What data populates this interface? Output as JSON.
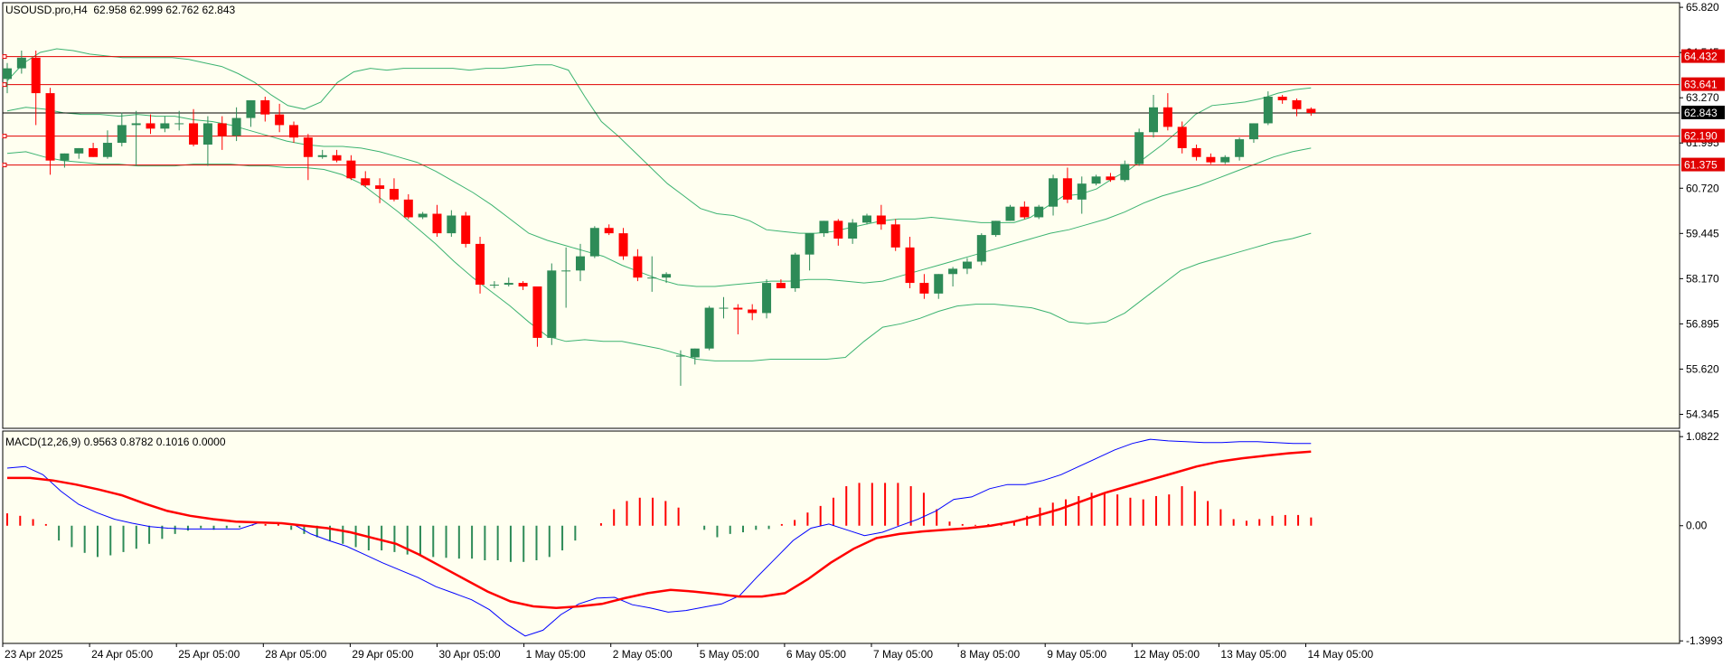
{
  "header": {
    "symbol_line": "USOUSD.pro,H4  62.958 62.999 62.762 62.843",
    "macd_line": "MACD(12,26,9) 0.9563 0.8782 0.1016 0.0000"
  },
  "colors": {
    "background": "#fffff0",
    "frame": "#000000",
    "bull": "#2e8b57",
    "bear": "#ff0000",
    "band": "#3cb371",
    "hline": "#e00000",
    "price_line": "#000000",
    "macd_main": "#0000ff",
    "macd_signal": "#ff0000"
  },
  "chart_data": [
    {
      "type": "candlestick",
      "title": "USOUSD.pro,H4",
      "ohlc_header": "62.958 62.999 62.762 62.843",
      "y_ticks": [
        "65.820",
        "64.545",
        "63.270",
        "61.995",
        "60.720",
        "59.445",
        "58.170",
        "56.895",
        "55.620",
        "54.345"
      ],
      "ylim": [
        53.95,
        65.95
      ],
      "x_labels": [
        "23 Apr 2025",
        "24 Apr 05:00",
        "25 Apr 05:00",
        "28 Apr 05:00",
        "29 Apr 05:00",
        "30 Apr 05:00",
        "1 May 05:00",
        "2 May 05:00",
        "5 May 05:00",
        "6 May 05:00",
        "7 May 05:00",
        "8 May 05:00",
        "9 May 05:00",
        "12 May 05:00",
        "13 May 05:00",
        "14 May 05:00"
      ],
      "horizontal_levels": [
        "64.432",
        "63.641",
        "62.190",
        "61.375"
      ],
      "current_price": "62.843",
      "candles": [
        [
          63.8,
          64.25,
          63.4,
          64.1
        ],
        [
          64.1,
          64.6,
          63.95,
          64.4
        ],
        [
          64.4,
          64.6,
          62.5,
          63.4
        ],
        [
          63.4,
          63.55,
          61.1,
          61.5
        ],
        [
          61.5,
          61.7,
          61.3,
          61.7
        ],
        [
          61.7,
          61.85,
          61.55,
          61.85
        ],
        [
          61.85,
          62.0,
          61.6,
          61.6
        ],
        [
          61.6,
          62.35,
          61.55,
          62.0
        ],
        [
          62.0,
          62.85,
          61.9,
          62.5
        ],
        [
          62.5,
          62.9,
          61.35,
          62.55
        ],
        [
          62.55,
          62.8,
          62.25,
          62.4
        ],
        [
          62.4,
          62.75,
          62.3,
          62.55
        ],
        [
          62.55,
          62.9,
          62.35,
          62.55
        ],
        [
          62.55,
          62.95,
          61.9,
          61.95
        ],
        [
          61.95,
          62.75,
          61.35,
          62.55
        ],
        [
          62.55,
          62.75,
          61.8,
          62.2
        ],
        [
          62.2,
          63.0,
          62.05,
          62.7
        ],
        [
          62.7,
          63.2,
          62.45,
          63.2
        ],
        [
          63.2,
          63.3,
          62.6,
          62.8
        ],
        [
          62.8,
          63.1,
          62.3,
          62.5
        ],
        [
          62.5,
          62.6,
          62.0,
          62.15
        ],
        [
          62.15,
          62.25,
          60.95,
          61.6
        ],
        [
          61.6,
          61.8,
          61.55,
          61.65
        ],
        [
          61.65,
          61.8,
          61.45,
          61.5
        ],
        [
          61.5,
          61.65,
          60.95,
          61.0
        ],
        [
          61.0,
          61.2,
          60.75,
          60.8
        ],
        [
          60.8,
          61.0,
          60.3,
          60.7
        ],
        [
          60.7,
          61.0,
          60.35,
          60.4
        ],
        [
          60.4,
          60.55,
          59.85,
          59.9
        ],
        [
          59.9,
          60.05,
          59.85,
          60.0
        ],
        [
          60.0,
          60.25,
          59.35,
          59.45
        ],
        [
          59.45,
          60.1,
          59.35,
          59.95
        ],
        [
          59.95,
          60.05,
          59.05,
          59.15
        ],
        [
          59.15,
          59.35,
          57.75,
          58.0
        ],
        [
          58.0,
          58.1,
          57.9,
          58.0
        ],
        [
          58.0,
          58.2,
          57.95,
          58.05
        ],
        [
          58.05,
          58.1,
          57.85,
          57.95
        ],
        [
          57.95,
          57.95,
          56.25,
          56.5
        ],
        [
          56.5,
          58.6,
          56.3,
          58.4
        ],
        [
          58.4,
          59.05,
          57.35,
          58.4
        ],
        [
          58.4,
          59.15,
          58.1,
          58.8
        ],
        [
          58.8,
          59.65,
          58.75,
          59.6
        ],
        [
          59.6,
          59.7,
          59.4,
          59.45
        ],
        [
          59.45,
          59.6,
          58.7,
          58.8
        ],
        [
          58.8,
          59.0,
          58.1,
          58.2
        ],
        [
          58.2,
          58.8,
          57.8,
          58.2
        ],
        [
          58.2,
          58.35,
          58.05,
          58.3
        ],
        [
          56.0,
          56.15,
          55.15,
          56.0
        ],
        [
          55.95,
          56.2,
          55.75,
          56.2
        ],
        [
          56.2,
          57.4,
          56.15,
          57.35
        ],
        [
          57.35,
          57.65,
          57.05,
          57.35
        ],
        [
          57.35,
          57.45,
          56.6,
          57.3
        ],
        [
          57.3,
          57.45,
          57.0,
          57.2
        ],
        [
          57.2,
          58.15,
          57.05,
          58.05
        ],
        [
          58.05,
          58.15,
          57.9,
          57.9
        ],
        [
          57.9,
          58.9,
          57.8,
          58.85
        ],
        [
          58.85,
          59.45,
          58.4,
          59.45
        ],
        [
          59.45,
          59.8,
          59.35,
          59.8
        ],
        [
          59.8,
          59.85,
          59.1,
          59.3
        ],
        [
          59.3,
          59.85,
          59.15,
          59.75
        ],
        [
          59.75,
          60.0,
          59.7,
          59.95
        ],
        [
          59.95,
          60.25,
          59.55,
          59.7
        ],
        [
          59.7,
          59.85,
          58.95,
          59.05
        ],
        [
          59.05,
          59.35,
          57.9,
          58.05
        ],
        [
          58.05,
          58.3,
          57.6,
          57.75
        ],
        [
          57.75,
          58.3,
          57.6,
          58.3
        ],
        [
          58.3,
          58.5,
          57.95,
          58.45
        ],
        [
          58.45,
          58.75,
          58.3,
          58.65
        ],
        [
          58.65,
          59.45,
          58.55,
          59.4
        ],
        [
          59.4,
          59.8,
          59.35,
          59.8
        ],
        [
          59.8,
          60.25,
          59.8,
          60.2
        ],
        [
          60.2,
          60.35,
          59.85,
          59.9
        ],
        [
          59.9,
          60.25,
          59.85,
          60.2
        ],
        [
          60.2,
          61.1,
          59.95,
          61.0
        ],
        [
          61.0,
          61.3,
          60.3,
          60.4
        ],
        [
          60.4,
          61.05,
          60.0,
          60.85
        ],
        [
          60.85,
          61.1,
          60.8,
          61.05
        ],
        [
          61.05,
          61.15,
          60.9,
          60.95
        ],
        [
          60.95,
          61.5,
          60.9,
          61.4
        ],
        [
          61.4,
          62.4,
          61.35,
          62.3
        ],
        [
          62.3,
          63.35,
          62.15,
          63.0
        ],
        [
          63.0,
          63.4,
          62.35,
          62.45
        ],
        [
          62.45,
          62.6,
          61.7,
          61.85
        ],
        [
          61.85,
          61.95,
          61.5,
          61.6
        ],
        [
          61.6,
          61.7,
          61.4,
          61.45
        ],
        [
          61.45,
          61.65,
          61.4,
          61.6
        ],
        [
          61.6,
          62.15,
          61.5,
          62.1
        ],
        [
          62.1,
          62.55,
          62.0,
          62.55
        ],
        [
          62.55,
          63.45,
          62.5,
          63.3
        ],
        [
          63.3,
          63.35,
          63.1,
          63.2
        ],
        [
          63.2,
          63.25,
          62.75,
          62.95
        ],
        [
          62.958,
          62.999,
          62.762,
          62.843
        ]
      ],
      "bollinger": {
        "upper": [
          63.75,
          64.25,
          64.55,
          64.65,
          64.6,
          64.5,
          64.45,
          64.4,
          64.4,
          64.4,
          64.4,
          64.35,
          64.25,
          64.15,
          63.95,
          63.7,
          63.35,
          63.05,
          62.95,
          63.15,
          63.7,
          64.0,
          64.1,
          64.05,
          64.1,
          64.1,
          64.1,
          64.1,
          64.05,
          64.1,
          64.1,
          64.15,
          64.2,
          64.2,
          64.05,
          63.3,
          62.6,
          62.2,
          61.75,
          61.3,
          60.85,
          60.5,
          60.15,
          60.0,
          59.95,
          59.8,
          59.55,
          59.5,
          59.45,
          59.45,
          59.5,
          59.6,
          59.7,
          59.8,
          59.85,
          59.85,
          59.9,
          59.85,
          59.8,
          59.75,
          59.75,
          59.75,
          59.9,
          60.2,
          60.5,
          60.55,
          60.7,
          61.0,
          61.25,
          61.6,
          61.95,
          62.35,
          62.8,
          63.05,
          63.1,
          63.15,
          63.25,
          63.4,
          63.5,
          63.55
        ],
        "middle": [
          62.9,
          63.0,
          62.95,
          62.85,
          62.8,
          62.8,
          62.75,
          62.8,
          62.75,
          62.75,
          62.65,
          62.6,
          62.5,
          62.35,
          62.2,
          62.05,
          61.95,
          61.9,
          61.9,
          61.85,
          61.75,
          61.6,
          61.45,
          61.2,
          60.9,
          60.6,
          60.25,
          59.85,
          59.45,
          59.25,
          59.1,
          58.95,
          58.8,
          58.55,
          58.35,
          58.15,
          58.0,
          57.95,
          57.95,
          58.0,
          58.05,
          58.1,
          58.1,
          58.15,
          58.15,
          58.1,
          58.05,
          58.1,
          58.25,
          58.4,
          58.55,
          58.7,
          58.85,
          59.0,
          59.15,
          59.3,
          59.45,
          59.55,
          59.7,
          59.85,
          60.05,
          60.3,
          60.5,
          60.65,
          60.8,
          61.0,
          61.2,
          61.4,
          61.6,
          61.75,
          61.85
        ],
        "lower": [
          61.7,
          61.75,
          61.6,
          61.5,
          61.45,
          61.4,
          61.4,
          61.35,
          61.35,
          61.35,
          61.4,
          61.4,
          61.4,
          61.35,
          61.35,
          61.3,
          61.3,
          61.25,
          61.1,
          60.85,
          60.45,
          60.05,
          59.6,
          59.15,
          58.65,
          58.2,
          57.8,
          57.4,
          56.95,
          56.55,
          56.4,
          56.45,
          56.4,
          56.4,
          56.3,
          56.2,
          56.05,
          55.9,
          55.85,
          55.85,
          55.85,
          55.9,
          55.9,
          55.9,
          55.9,
          55.95,
          56.4,
          56.8,
          56.9,
          57.05,
          57.25,
          57.4,
          57.45,
          57.45,
          57.4,
          57.35,
          57.2,
          56.95,
          56.9,
          56.95,
          57.2,
          57.6,
          58.0,
          58.4,
          58.6,
          58.75,
          58.9,
          59.05,
          59.2,
          59.3,
          59.45
        ]
      }
    },
    {
      "type": "macd",
      "title": "MACD(12,26,9)",
      "values_header": "0.9563 0.8782 0.1016 0.0000",
      "y_ticks": [
        "1.0822",
        "0.00",
        "-1.3993"
      ],
      "ylim": [
        -1.43,
        1.15
      ],
      "histogram": [
        0.15,
        0.12,
        0.08,
        0.02,
        -0.18,
        -0.26,
        -0.33,
        -0.38,
        -0.36,
        -0.32,
        -0.28,
        -0.22,
        -0.16,
        -0.1,
        -0.06,
        -0.03,
        -0.05,
        -0.03,
        -0.02,
        0.01,
        0.02,
        0.02,
        -0.05,
        -0.1,
        -0.14,
        -0.18,
        -0.22,
        -0.26,
        -0.3,
        -0.3,
        -0.32,
        -0.35,
        -0.36,
        -0.38,
        -0.39,
        -0.4,
        -0.4,
        -0.42,
        -0.42,
        -0.44,
        -0.44,
        -0.42,
        -0.38,
        -0.3,
        -0.18,
        0.0,
        0.03,
        0.2,
        0.3,
        0.34,
        0.34,
        0.3,
        0.22,
        0.0,
        -0.05,
        -0.14,
        -0.1,
        -0.08,
        -0.05,
        -0.04,
        0.02,
        0.07,
        0.16,
        0.24,
        0.34,
        0.48,
        0.52,
        0.52,
        0.52,
        0.52,
        0.48,
        0.4,
        0.2,
        0.05,
        0.02,
        0.01,
        0.02,
        0.03,
        0.06,
        0.12,
        0.22,
        0.28,
        0.32,
        0.36,
        0.4,
        0.4,
        0.38,
        0.34,
        0.32,
        0.36,
        0.38,
        0.48,
        0.42,
        0.3,
        0.2,
        0.08,
        0.06,
        0.08,
        0.12,
        0.13,
        0.13,
        0.1
      ],
      "macd_main": [
        0.7,
        0.72,
        0.62,
        0.42,
        0.26,
        0.16,
        0.08,
        0.03,
        -0.01,
        -0.03,
        -0.04,
        -0.04,
        -0.04,
        -0.04,
        0.03,
        0.04,
        0.02,
        -0.1,
        -0.18,
        -0.25,
        -0.35,
        -0.45,
        -0.54,
        -0.63,
        -0.74,
        -0.82,
        -0.9,
        -1.02,
        -1.2,
        -1.34,
        -1.27,
        -1.08,
        -0.95,
        -0.88,
        -0.87,
        -0.96,
        -1.0,
        -1.05,
        -1.03,
        -0.99,
        -0.95,
        -0.85,
        -0.62,
        -0.4,
        -0.18,
        -0.03,
        0.02,
        -0.05,
        -0.12,
        -0.08,
        0.0,
        0.08,
        0.18,
        0.32,
        0.35,
        0.45,
        0.5,
        0.5,
        0.55,
        0.62,
        0.72,
        0.82,
        0.92,
        1.0,
        1.05,
        1.03,
        1.02,
        1.01,
        1.01,
        1.02,
        1.02,
        1.01,
        1.0,
        1.0
      ],
      "macd_signal": [
        0.58,
        0.58,
        0.55,
        0.5,
        0.44,
        0.37,
        0.27,
        0.18,
        0.12,
        0.08,
        0.05,
        0.04,
        0.03,
        0.0,
        -0.03,
        -0.08,
        -0.15,
        -0.22,
        -0.35,
        -0.5,
        -0.65,
        -0.8,
        -0.92,
        -0.98,
        -1.0,
        -0.98,
        -0.95,
        -0.88,
        -0.82,
        -0.78,
        -0.8,
        -0.83,
        -0.86,
        -0.86,
        -0.82,
        -0.65,
        -0.45,
        -0.28,
        -0.15,
        -0.1,
        -0.07,
        -0.05,
        -0.03,
        0.0,
        0.05,
        0.12,
        0.2,
        0.3,
        0.4,
        0.48,
        0.56,
        0.64,
        0.72,
        0.78,
        0.82,
        0.85,
        0.88,
        0.9
      ]
    }
  ]
}
